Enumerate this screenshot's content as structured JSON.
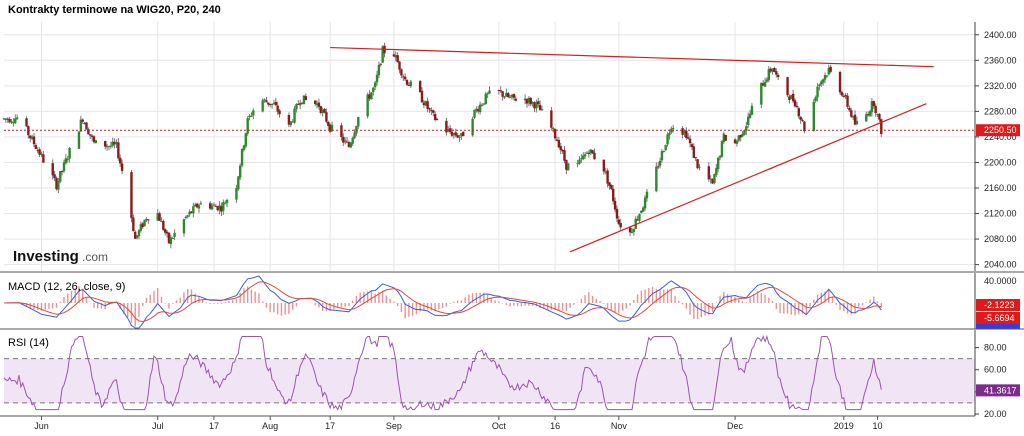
{
  "chart_data": [
    {
      "type": "candlestick",
      "title": "Kontrakty terminowe na WIG20, P20, 240",
      "watermark": "Investing",
      "watermark_suffix": ".com",
      "ylim": [
        2030,
        2420
      ],
      "y_ticks": [
        "2400.00",
        "2360.00",
        "2320.00",
        "2280.00",
        "2240.00",
        "2200.00",
        "2160.00",
        "2120.00",
        "2080.00",
        "2040.00"
      ],
      "y_tick_values": [
        2400,
        2360,
        2320,
        2280,
        2240,
        2200,
        2160,
        2120,
        2080,
        2040
      ],
      "x_ticks": [
        "Jun",
        "Jul",
        "17",
        "Aug",
        "17",
        "Sep",
        "Oct",
        "16",
        "Nov",
        "Dec",
        "2019",
        "10"
      ],
      "x_tick_dates": [
        "2018-06-01",
        "2018-07-02",
        "2018-07-17",
        "2018-08-01",
        "2018-08-17",
        "2018-09-03",
        "2018-10-01",
        "2018-10-16",
        "2018-11-02",
        "2018-12-03",
        "2019-01-01",
        "2019-01-10"
      ],
      "x_range": [
        "2018-05-22",
        "2019-02-05"
      ],
      "current_price": "2250.50",
      "current_price_value": 2250.5,
      "price_path": [
        [
          "2018-05-22",
          2268
        ],
        [
          "2018-05-26",
          2270
        ],
        [
          "2018-05-31",
          2220
        ],
        [
          "2018-06-05",
          2165
        ],
        [
          "2018-06-09",
          2225
        ],
        [
          "2018-06-12",
          2270
        ],
        [
          "2018-06-15",
          2230
        ],
        [
          "2018-06-21",
          2225
        ],
        [
          "2018-06-24",
          2150
        ],
        [
          "2018-06-26",
          2080
        ],
        [
          "2018-06-29",
          2115
        ],
        [
          "2018-07-02",
          2120
        ],
        [
          "2018-07-05",
          2075
        ],
        [
          "2018-07-09",
          2110
        ],
        [
          "2018-07-13",
          2135
        ],
        [
          "2018-07-19",
          2130
        ],
        [
          "2018-07-23",
          2165
        ],
        [
          "2018-07-26",
          2265
        ],
        [
          "2018-07-29",
          2300
        ],
        [
          "2018-08-02",
          2290
        ],
        [
          "2018-08-06",
          2255
        ],
        [
          "2018-08-09",
          2300
        ],
        [
          "2018-08-14",
          2290
        ],
        [
          "2018-08-17",
          2255
        ],
        [
          "2018-08-22",
          2225
        ],
        [
          "2018-08-25",
          2280
        ],
        [
          "2018-08-29",
          2320
        ],
        [
          "2018-08-31",
          2375
        ],
        [
          "2018-09-03",
          2370
        ],
        [
          "2018-09-06",
          2330
        ],
        [
          "2018-09-10",
          2305
        ],
        [
          "2018-09-13",
          2275
        ],
        [
          "2018-09-17",
          2250
        ],
        [
          "2018-09-21",
          2240
        ],
        [
          "2018-09-24",
          2275
        ],
        [
          "2018-09-28",
          2305
        ],
        [
          "2018-10-01",
          2310
        ],
        [
          "2018-10-04",
          2300
        ],
        [
          "2018-10-08",
          2300
        ],
        [
          "2018-10-11",
          2290
        ],
        [
          "2018-10-14",
          2265
        ],
        [
          "2018-10-17",
          2230
        ],
        [
          "2018-10-19",
          2195
        ],
        [
          "2018-10-22",
          2195
        ],
        [
          "2018-10-25",
          2220
        ],
        [
          "2018-10-29",
          2190
        ],
        [
          "2018-10-31",
          2155
        ],
        [
          "2018-11-02",
          2105
        ],
        [
          "2018-11-05",
          2090
        ],
        [
          "2018-11-09",
          2140
        ],
        [
          "2018-11-13",
          2205
        ],
        [
          "2018-11-16",
          2260
        ],
        [
          "2018-11-20",
          2245
        ],
        [
          "2018-11-23",
          2195
        ],
        [
          "2018-11-27",
          2165
        ],
        [
          "2018-11-30",
          2240
        ],
        [
          "2018-12-03",
          2230
        ],
        [
          "2018-12-06",
          2260
        ],
        [
          "2018-12-09",
          2310
        ],
        [
          "2018-12-13",
          2350
        ],
        [
          "2018-12-15",
          2320
        ],
        [
          "2018-12-19",
          2295
        ],
        [
          "2018-12-22",
          2245
        ],
        [
          "2018-12-25",
          2320
        ],
        [
          "2018-12-28",
          2345
        ],
        [
          "2019-01-01",
          2305
        ],
        [
          "2019-01-04",
          2260
        ],
        [
          "2019-01-06",
          2265
        ],
        [
          "2019-01-09",
          2295
        ],
        [
          "2019-01-11",
          2250
        ]
      ],
      "trendlines": [
        {
          "from": [
            "2018-08-17",
            2380
          ],
          "to": [
            "2019-01-25",
            2350
          ]
        },
        {
          "from": [
            "2018-10-20",
            2060
          ],
          "to": [
            "2019-01-23",
            2292
          ]
        }
      ]
    },
    {
      "type": "line",
      "title": "MACD (12, 26, close, 9)",
      "ylim": [
        -9,
        16
      ],
      "y_ticks": [
        "40.0000"
      ],
      "last_values": [
        "-2.1223",
        "-5.6694"
      ],
      "series": []
    },
    {
      "type": "line",
      "title": "RSI (14)",
      "ylim": [
        20,
        95
      ],
      "y_ticks": [
        "80.00",
        "60.00",
        "40.00",
        "20.00"
      ],
      "y_tick_values": [
        80,
        60,
        40,
        20
      ],
      "bands": [
        30,
        70
      ],
      "last_value": "41.3617",
      "last_value_num": 41.36,
      "series": []
    }
  ],
  "colors": {
    "up": "#2b8a2b",
    "down": "#8b1a1a",
    "trendline": "#e0191b",
    "price_badge": "#e0191b",
    "macd_line": "#3a5de0",
    "signal_line": "#e04a3a",
    "histogram": "#f09090",
    "rsi_line": "#9a55b0",
    "rsi_band_fill": "#f1e4f4",
    "rsi_badge": "#7b2d8a",
    "macd_badge_1": "#e0191b",
    "macd_badge_2": "#e0191b"
  }
}
